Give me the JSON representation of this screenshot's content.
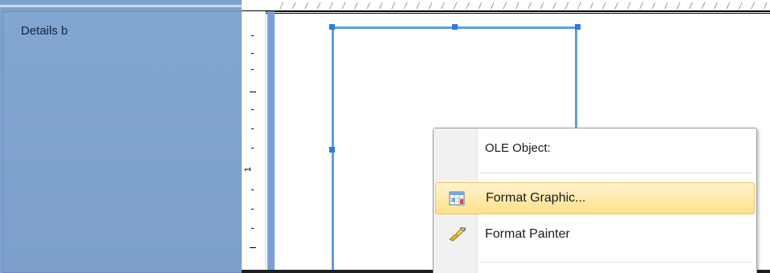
{
  "section": {
    "label": "Details b"
  },
  "ruler": {
    "mark_label": "1"
  },
  "context_menu": {
    "header": "OLE Object:",
    "items": [
      {
        "label": "Format Graphic...",
        "icon": "format-graphic-icon",
        "highlighted": true
      },
      {
        "label": "Format Painter",
        "icon": "paintbrush-icon",
        "highlighted": false
      }
    ]
  },
  "colors": {
    "section_panel": "#7ea2cf",
    "selection_border": "#5aa0e2",
    "menu_highlight": "#ffe088"
  }
}
